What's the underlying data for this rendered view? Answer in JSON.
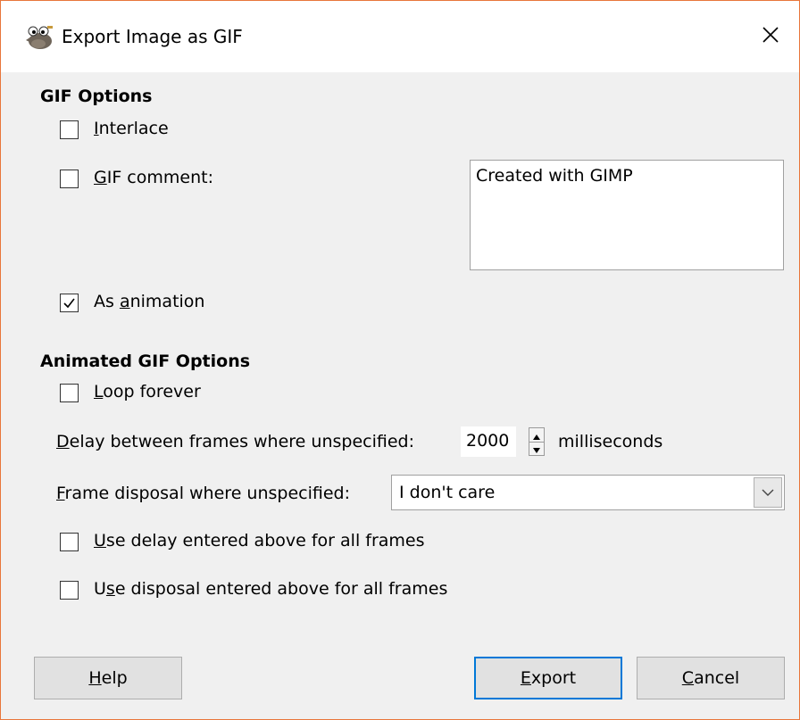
{
  "window": {
    "title": "Export Image as GIF",
    "app_icon": "gimp-wilber-icon",
    "close_icon": "close-icon",
    "accent_color": "#e8763b"
  },
  "gif_options": {
    "heading": "GIF Options",
    "interlace": {
      "mnemonic": "I",
      "rest": "nterlace",
      "checked": false
    },
    "gif_comment": {
      "mnemonic": "G",
      "rest": "IF comment:",
      "checked": false
    },
    "comment_text": "Created with GIMP",
    "as_animation": {
      "pre": "As ",
      "mnemonic": "a",
      "rest": "nimation",
      "checked": true
    }
  },
  "animated_options": {
    "heading": "Animated GIF Options",
    "loop_forever": {
      "mnemonic": "L",
      "rest": "oop forever",
      "checked": false
    },
    "delay": {
      "mnemonic": "D",
      "rest": "elay between frames where unspecified:",
      "value": "2000",
      "unit": "milliseconds"
    },
    "disposal": {
      "mnemonic": "F",
      "rest": "rame disposal where unspecified:",
      "selected": "I don't care"
    },
    "use_delay": {
      "mnemonic": "U",
      "rest": "se delay entered above for all frames",
      "checked": false
    },
    "use_disposal": {
      "pre": "U",
      "mnemonic": "s",
      "rest": "e disposal entered above for all frames",
      "checked": false
    }
  },
  "buttons": {
    "help": {
      "mnemonic": "H",
      "rest": "elp"
    },
    "export": {
      "mnemonic": "E",
      "rest": "xport",
      "is_default": true,
      "border_color": "#0078d7"
    },
    "cancel": {
      "mnemonic": "C",
      "rest": "ancel"
    }
  }
}
